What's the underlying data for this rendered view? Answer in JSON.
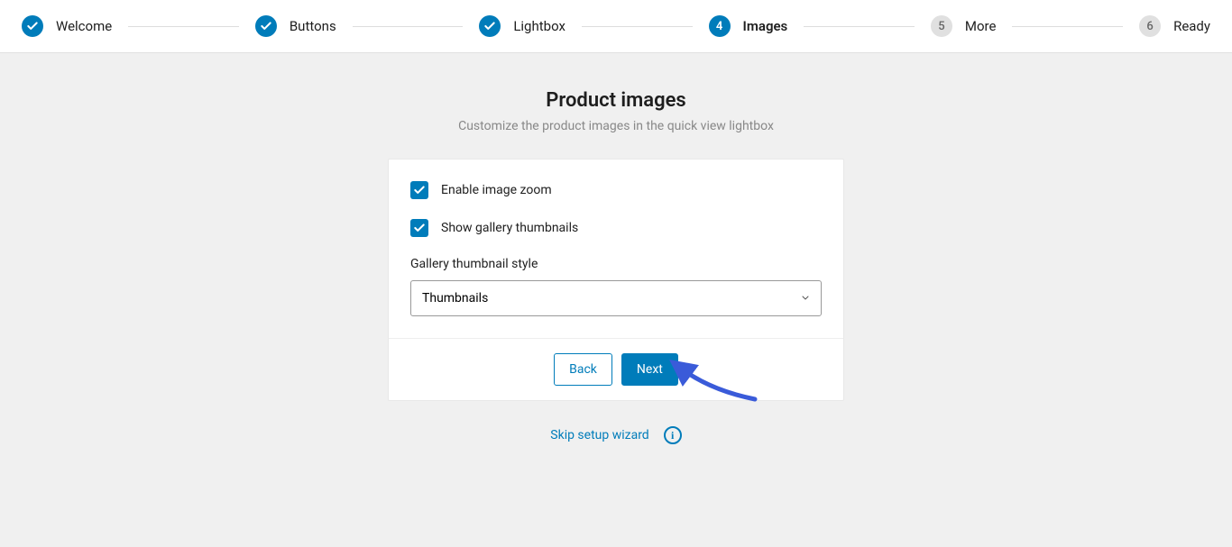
{
  "steps": [
    {
      "label": "Welcome",
      "state": "done"
    },
    {
      "label": "Buttons",
      "state": "done"
    },
    {
      "label": "Lightbox",
      "state": "done"
    },
    {
      "label": "Images",
      "state": "current",
      "number": "4"
    },
    {
      "label": "More",
      "state": "future",
      "number": "5"
    },
    {
      "label": "Ready",
      "state": "future",
      "number": "6"
    }
  ],
  "header": {
    "title": "Product images",
    "subtitle": "Customize the product images in the quick view lightbox"
  },
  "form": {
    "enable_zoom_label": "Enable image zoom",
    "show_thumbs_label": "Show gallery thumbnails",
    "gallery_style_label": "Gallery thumbnail style",
    "gallery_style_value": "Thumbnails"
  },
  "buttons": {
    "back": "Back",
    "next": "Next"
  },
  "footer": {
    "skip_label": "Skip setup wizard"
  },
  "info_char": "i"
}
